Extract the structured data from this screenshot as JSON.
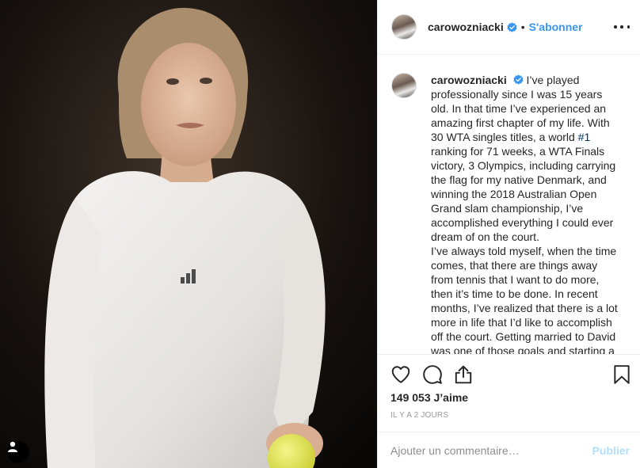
{
  "photo": {
    "alt_icon": "user-tag-icon"
  },
  "header": {
    "username": "carowozniacki",
    "separator": "•",
    "follow_label": "S'abonner",
    "more_icon": "more-horizontal-icon",
    "verified_icon": "verified-badge-icon"
  },
  "caption": {
    "username": "carowozniacki",
    "text_before_hashtag": "I’ve played professionally since I was 15 years old. In that time I’ve experienced an amazing first chapter of my life. With 30 WTA singles titles, a world ",
    "hashtag": "#1",
    "text_after_hashtag": " ranking for 71 weeks, a WTA Finals victory, 3 Olympics, including carrying the flag for my native Denmark, and winning the 2018 Australian Open Grand slam championship, I’ve accomplished everything I could ever dream of on the court.",
    "paragraph2": "I’ve always told myself, when the time comes, that there are things away from tennis that I want to do more, then it’s time to be done. In recent months, I’ve realized that there is a lot more in life that I’d like to accomplish off the court. Getting married to David was one of those goals and starting a"
  },
  "actions": {
    "like_icon": "heart-icon",
    "comment_icon": "comment-icon",
    "share_icon": "share-icon",
    "save_icon": "bookmark-icon"
  },
  "stats": {
    "likes": "149 053 J’aime",
    "time_ago": "IL Y A 2 JOURS"
  },
  "comment": {
    "placeholder": "Ajouter un commentaire…",
    "publish_label": "Publier"
  },
  "colors": {
    "accent": "#3897f0",
    "publish_disabled": "#b2dffc",
    "hashtag": "#003569",
    "border": "#efefef"
  }
}
